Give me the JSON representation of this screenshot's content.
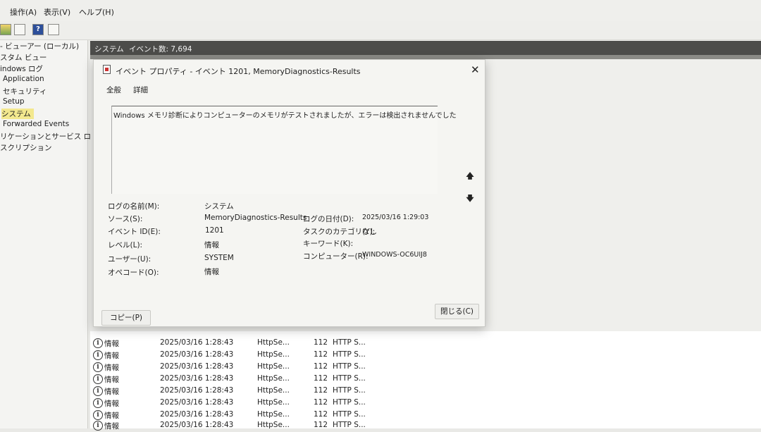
{
  "menu": {
    "action": "操作(A)",
    "view": "表示(V)",
    "help": "ヘルプ(H)"
  },
  "tree": {
    "items": [
      "- ビューアー (ローカル)",
      "スタム ビュー",
      "indows ログ",
      "Application",
      "セキュリティ",
      "Setup",
      "システム",
      "Forwarded Events",
      "リケーションとサービス ログ",
      "スクリプション"
    ]
  },
  "header": {
    "log_name": "システム",
    "event_count": "イベント数: 7,694"
  },
  "dialog": {
    "title": "イベント プロパティ - イベント 1201, MemoryDiagnostics-Results",
    "tabs": [
      "全般",
      "詳細"
    ],
    "message": "Windows メモリ診断によりコンピューターのメモリがテストされましたが、エラーは検出されませんでした",
    "fields": {
      "log_name_label": "ログの名前(M):",
      "log_name": "システム",
      "source_label": "ソース(S):",
      "source": "MemoryDiagnostics-Results",
      "date_label": "ログの日付(D):",
      "date": "2025/03/16 1:29:03",
      "event_id_label": "イベント ID(E):",
      "event_id": "1201",
      "task_category_label": "タスクのカテゴリ(Y):",
      "task_category": "なし",
      "level_label": "レベル(L):",
      "level": "情報",
      "keyword_label": "キーワード(K):",
      "keyword": "",
      "user_label": "ユーザー(U):",
      "user": "SYSTEM",
      "computer_label": "コンピューター(R):",
      "computer": "WINDOWS-OC6UIJ8",
      "opcode_label": "オペコード(O):",
      "opcode": "情報"
    },
    "copy_button": "コピー(P)",
    "close_button": "閉じる(C)"
  },
  "events": [
    {
      "level": "情報",
      "date": "2025/03/16 1:28:43",
      "source": "HttpSe...",
      "id": "112",
      "task": "HTTP S..."
    },
    {
      "level": "情報",
      "date": "2025/03/16 1:28:43",
      "source": "HttpSe...",
      "id": "112",
      "task": "HTTP S..."
    },
    {
      "level": "情報",
      "date": "2025/03/16 1:28:43",
      "source": "HttpSe...",
      "id": "112",
      "task": "HTTP S..."
    },
    {
      "level": "情報",
      "date": "2025/03/16 1:28:43",
      "source": "HttpSe...",
      "id": "112",
      "task": "HTTP S..."
    },
    {
      "level": "情報",
      "date": "2025/03/16 1:28:43",
      "source": "HttpSe...",
      "id": "112",
      "task": "HTTP S..."
    },
    {
      "level": "情報",
      "date": "2025/03/16 1:28:43",
      "source": "HttpSe...",
      "id": "112",
      "task": "HTTP S..."
    },
    {
      "level": "情報",
      "date": "2025/03/16 1:28:43",
      "source": "HttpSe...",
      "id": "112",
      "task": "HTTP S..."
    },
    {
      "level": "情報",
      "date": "2025/03/16 1:28:43",
      "source": "HttpSe...",
      "id": "112",
      "task": "HTTP S..."
    }
  ]
}
